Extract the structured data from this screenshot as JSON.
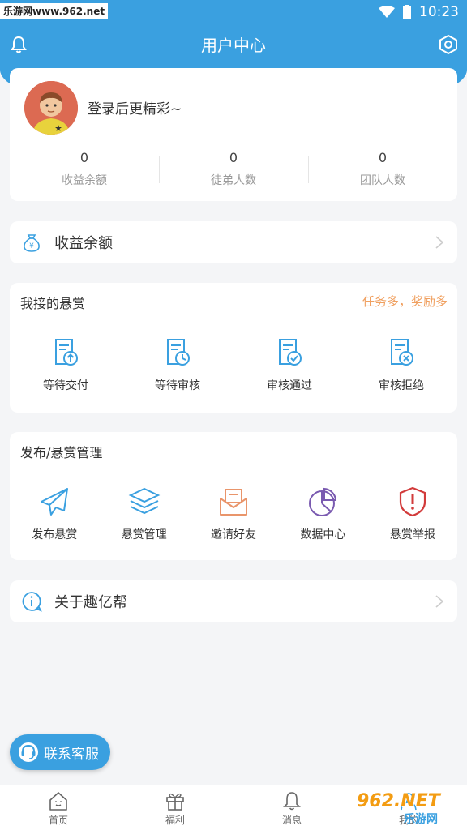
{
  "watermark": {
    "site": "乐游网www.962.net",
    "brand_big": "962.NET",
    "brand_small": "乐游网"
  },
  "status": {
    "time": "10:23"
  },
  "header": {
    "title": "用户中心"
  },
  "user": {
    "login_prompt": "登录后更精彩~",
    "stats": [
      {
        "value": "0",
        "label": "收益余额"
      },
      {
        "value": "0",
        "label": "徒弟人数"
      },
      {
        "value": "0",
        "label": "团队人数"
      }
    ]
  },
  "balance": {
    "label": "收益余额"
  },
  "my_rewards": {
    "title": "我接的悬赏",
    "extra": "任务多，奖励多",
    "items": [
      {
        "label": "等待交付",
        "icon": "doc-upload-icon"
      },
      {
        "label": "等待审核",
        "icon": "doc-clock-icon"
      },
      {
        "label": "审核通过",
        "icon": "doc-check-icon"
      },
      {
        "label": "审核拒绝",
        "icon": "doc-reject-icon"
      }
    ]
  },
  "publish": {
    "title": "发布/悬赏管理",
    "items": [
      {
        "label": "发布悬赏",
        "icon": "paper-plane-icon"
      },
      {
        "label": "悬赏管理",
        "icon": "layers-icon"
      },
      {
        "label": "邀请好友",
        "icon": "envelope-icon"
      },
      {
        "label": "数据中心",
        "icon": "pie-chart-icon"
      },
      {
        "label": "悬赏举报",
        "icon": "shield-alert-icon"
      }
    ]
  },
  "about": {
    "label": "关于趣亿帮"
  },
  "contact": {
    "label": "联系客服"
  },
  "tabs": [
    {
      "label": "首页",
      "icon": "home-icon"
    },
    {
      "label": "福利",
      "icon": "gift-icon"
    },
    {
      "label": "消息",
      "icon": "bell-icon"
    },
    {
      "label": "我的",
      "icon": "user-icon"
    }
  ],
  "colors": {
    "primary": "#3aa0e0",
    "accent": "#f0a060",
    "background": "#f4f5f7"
  }
}
